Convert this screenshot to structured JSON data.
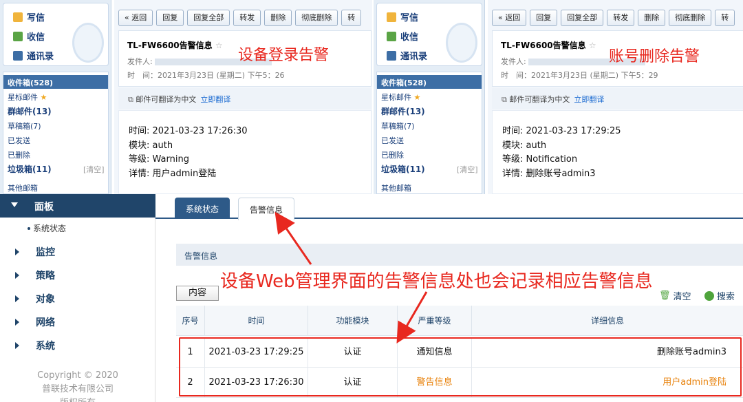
{
  "mail_left": {
    "nav": {
      "compose": "写信",
      "inbox": "收信",
      "contacts": "通讯录"
    },
    "folders": {
      "inbox": "收件箱(528)",
      "starred": "星标邮件",
      "group": "群邮件(13)",
      "drafts": "草稿箱(7)",
      "sent": "已发送",
      "deleted": "已删除",
      "spam": "垃圾箱(11)",
      "clear": "[清空]",
      "other": "其他邮箱"
    },
    "toolbar": [
      "« 返回",
      "回复",
      "回复全部",
      "转发",
      "删除",
      "彻底删除",
      "转"
    ],
    "subject": "TL-FW6600告警信息",
    "sender_label": "发件人:",
    "time_label": "时　间：2021年3月23日 (星期二) 下午5：26",
    "translate": "邮件可翻译为中文",
    "translate_link": "立即翻译",
    "body": [
      "时间: 2021-03-23 17:26:30",
      "模块: auth",
      "等级: Warning",
      "详情: 用户admin登陆"
    ],
    "note": "设备登录告警"
  },
  "mail_right": {
    "nav": {
      "compose": "写信",
      "inbox": "收信",
      "contacts": "通讯录"
    },
    "folders": {
      "inbox": "收件箱(528)",
      "starred": "星标邮件",
      "group": "群邮件(13)",
      "drafts": "草稿箱(7)",
      "sent": "已发送",
      "deleted": "已删除",
      "spam": "垃圾箱(11)",
      "clear": "[清空]",
      "other": "其他邮箱"
    },
    "toolbar": [
      "« 返回",
      "回复",
      "回复全部",
      "转发",
      "删除",
      "彻底删除",
      "转"
    ],
    "subject": "TL-FW6600告警信息",
    "sender_label": "发件人:",
    "time_label": "时　间：2021年3月23日 (星期二) 下午5：29",
    "translate": "邮件可翻译为中文",
    "translate_link": "立即翻译",
    "body": [
      "时间: 2021-03-23 17:29:25",
      "模块: auth",
      "等级: Notification",
      "详情: 删除账号admin3"
    ],
    "note": "账号删除告警"
  },
  "admin": {
    "menu_head": "面板",
    "submenu": "系统状态",
    "menu": [
      "监控",
      "策略",
      "对象",
      "网络",
      "系统"
    ],
    "copyright": [
      "Copyright © 2020",
      "普联技术有限公司",
      "版权所有"
    ],
    "tabs": [
      "系统状态",
      "告警信息"
    ],
    "section_title": "告警信息",
    "content_button": "内容",
    "clear": "清空",
    "search": "搜索",
    "headers": [
      "序号",
      "时间",
      "功能模块",
      "严重等级",
      "详细信息"
    ],
    "rows": [
      {
        "no": "1",
        "time": "2021-03-23 17:29:25",
        "module": "认证",
        "level": "通知信息",
        "detail": "删除账号admin3"
      },
      {
        "no": "2",
        "time": "2021-03-23 17:26:30",
        "module": "认证",
        "level": "警告信息",
        "detail": "用户admin登陆"
      }
    ],
    "note": "设备Web管理界面的告警信息处也会记录相应告警信息"
  }
}
